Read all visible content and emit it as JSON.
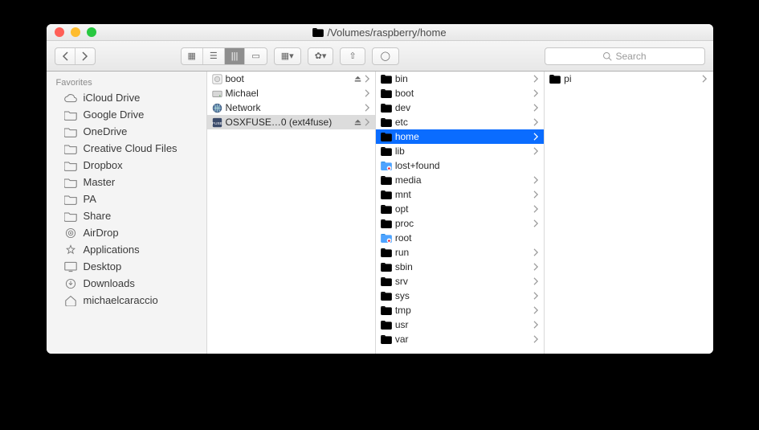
{
  "window": {
    "path": "/Volumes/raspberry/home"
  },
  "toolbar": {
    "search_placeholder": "Search"
  },
  "sidebar": {
    "section": "Favorites",
    "items": [
      {
        "label": "iCloud Drive",
        "icon": "cloud"
      },
      {
        "label": "Google Drive",
        "icon": "folder"
      },
      {
        "label": "OneDrive",
        "icon": "folder"
      },
      {
        "label": "Creative Cloud Files",
        "icon": "folder"
      },
      {
        "label": "Dropbox",
        "icon": "folder"
      },
      {
        "label": "Master",
        "icon": "folder"
      },
      {
        "label": "PA",
        "icon": "folder"
      },
      {
        "label": "Share",
        "icon": "folder"
      },
      {
        "label": "AirDrop",
        "icon": "airdrop"
      },
      {
        "label": "Applications",
        "icon": "app"
      },
      {
        "label": "Desktop",
        "icon": "desktop"
      },
      {
        "label": "Downloads",
        "icon": "download"
      },
      {
        "label": "michaelcaraccio",
        "icon": "home"
      }
    ]
  },
  "col0": {
    "items": [
      {
        "label": "boot",
        "icon": "drive",
        "eject": true,
        "chev": true
      },
      {
        "label": "Michael",
        "icon": "drive-int",
        "chev": true
      },
      {
        "label": "Network",
        "icon": "globe",
        "chev": true
      },
      {
        "label": "OSXFUSE…0 (ext4fuse)",
        "icon": "fuse",
        "eject": true,
        "chev": true,
        "selected": "grey"
      }
    ]
  },
  "col1": {
    "items": [
      {
        "label": "bin",
        "chev": true
      },
      {
        "label": "boot",
        "chev": true
      },
      {
        "label": "dev",
        "chev": true
      },
      {
        "label": "etc",
        "chev": true
      },
      {
        "label": "home",
        "chev": true,
        "selected": "blue"
      },
      {
        "label": "lib",
        "chev": true
      },
      {
        "label": "lost+found",
        "locked": true
      },
      {
        "label": "media",
        "chev": true
      },
      {
        "label": "mnt",
        "chev": true
      },
      {
        "label": "opt",
        "chev": true
      },
      {
        "label": "proc",
        "chev": true
      },
      {
        "label": "root",
        "locked": true
      },
      {
        "label": "run",
        "chev": true
      },
      {
        "label": "sbin",
        "chev": true
      },
      {
        "label": "srv",
        "chev": true
      },
      {
        "label": "sys",
        "chev": true
      },
      {
        "label": "tmp",
        "chev": true
      },
      {
        "label": "usr",
        "chev": true
      },
      {
        "label": "var",
        "chev": true
      }
    ]
  },
  "col2": {
    "items": [
      {
        "label": "pi",
        "chev": true
      }
    ]
  }
}
